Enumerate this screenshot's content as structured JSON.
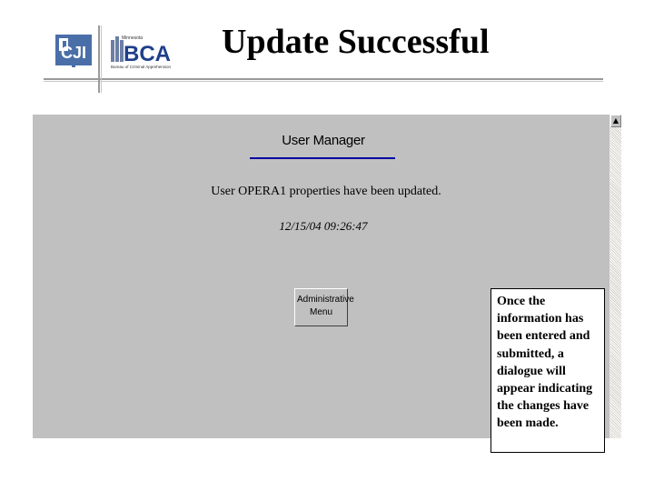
{
  "slide": {
    "title": "Update Successful",
    "logos": {
      "left": {
        "icon": "cji-logo",
        "text": "CJI"
      },
      "right": {
        "icon": "bca-logo",
        "text": "BCA",
        "subtext": "Bureau of Criminal Apprehension",
        "supertext": "Minnesota"
      }
    }
  },
  "screen": {
    "title": "User Manager",
    "message": "User OPERA1 properties have been updated.",
    "timestamp": "12/15/04 09:26:47",
    "button": {
      "line1": "Administrative",
      "line2": "Menu"
    },
    "scrollbar": {
      "up_icon": "scroll-up-arrow-icon",
      "up_glyph": "▲"
    },
    "colors": {
      "background": "#c0c0c0",
      "rule": "#0000a0"
    }
  },
  "callout": {
    "text": "Once the information has been entered and submitted, a dialogue will appear indicating the changes have been made."
  }
}
